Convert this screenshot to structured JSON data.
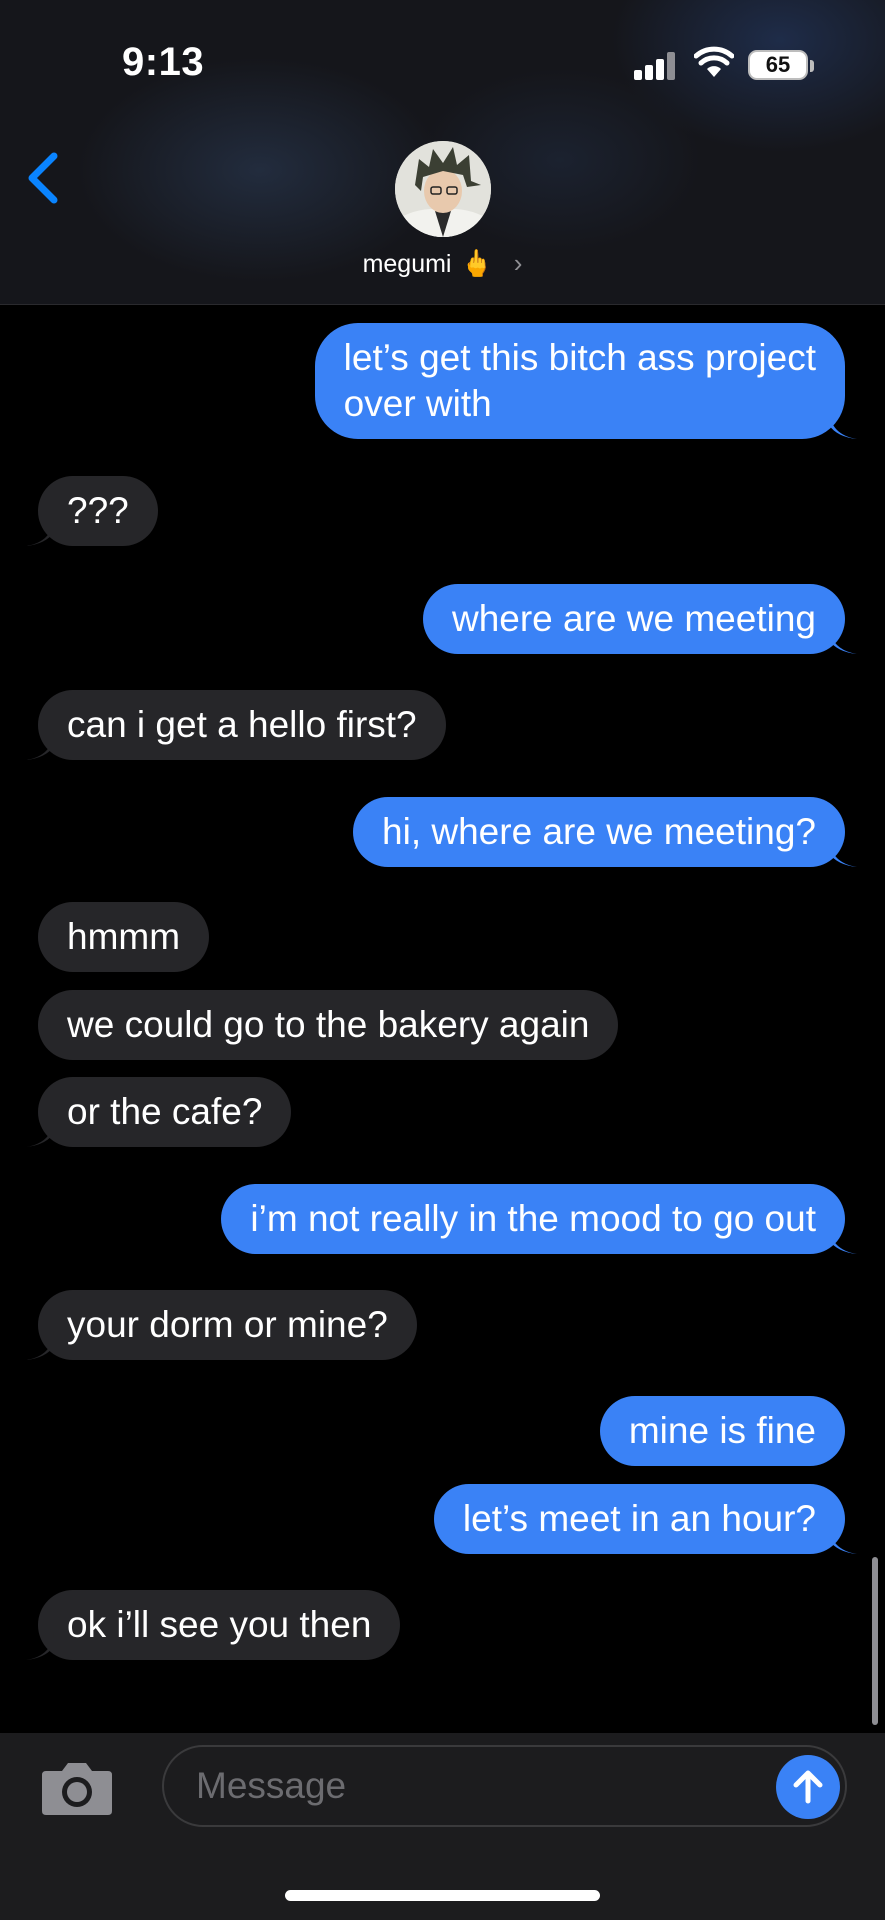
{
  "status_bar": {
    "time": "9:13",
    "battery": "65"
  },
  "header": {
    "contact_name": "megumi",
    "contact_emoji": "🖕"
  },
  "messages": [
    {
      "from": "me",
      "text": "let’s get this bitch ass project",
      "text2": "over with"
    },
    {
      "from": "them",
      "text": "???"
    },
    {
      "from": "me",
      "text": "where are we meeting"
    },
    {
      "from": "them",
      "text": "can i get a hello first?"
    },
    {
      "from": "me",
      "text": "hi, where are we meeting?"
    },
    {
      "from": "them",
      "text": "hmmm"
    },
    {
      "from": "them",
      "text": "we could go to the bakery again"
    },
    {
      "from": "them",
      "text": "or the cafe?"
    },
    {
      "from": "me",
      "text": "i’m not really in the mood to go out"
    },
    {
      "from": "them",
      "text": "your dorm or mine?"
    },
    {
      "from": "me",
      "text": "mine is fine"
    },
    {
      "from": "me",
      "text": "let’s meet in an hour?"
    },
    {
      "from": "them",
      "text": "ok i’ll see you then"
    }
  ],
  "composer": {
    "placeholder": "Message"
  },
  "colors": {
    "sent_bubble": "#3a82f6",
    "received_bubble": "#262629",
    "accent": "#0a84ff"
  },
  "icons": [
    "back-chevron-icon",
    "camera-icon",
    "send-arrow-icon",
    "signal-icon",
    "wifi-icon",
    "battery-icon"
  ]
}
